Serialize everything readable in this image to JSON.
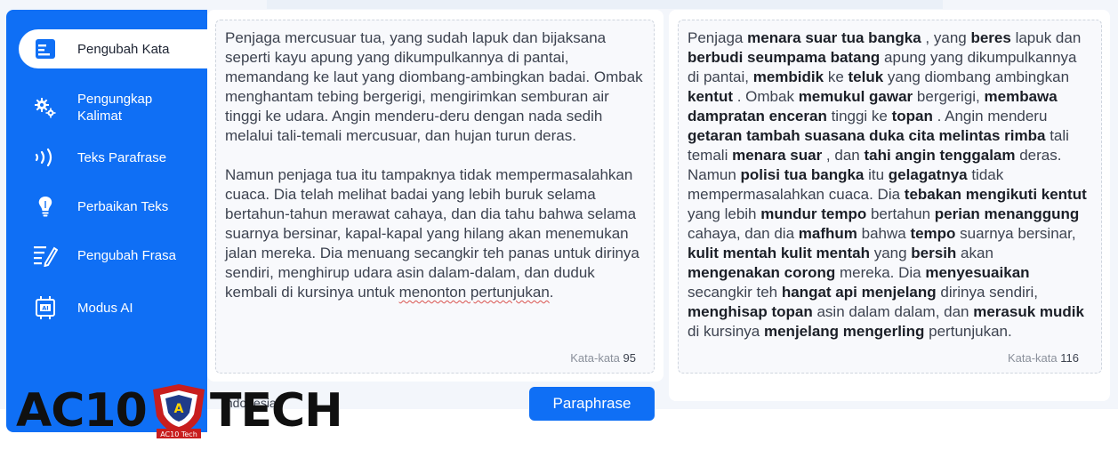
{
  "sidebar": {
    "items": [
      {
        "label": "Pengubah Kata",
        "icon": "document-icon",
        "active": true
      },
      {
        "label": "Pengungkap\nKalimat",
        "icon": "gears-icon",
        "active": false
      },
      {
        "label": "Teks Parafrase",
        "icon": "sound-waves-icon",
        "active": false
      },
      {
        "label": "Perbaikan Teks",
        "icon": "lightbulb-icon",
        "active": false
      },
      {
        "label": "Pengubah Frasa",
        "icon": "list-pencil-icon",
        "active": false
      },
      {
        "label": "Modus AI",
        "icon": "ai-chip-icon",
        "active": false
      }
    ]
  },
  "input": {
    "p1": "Penjaga mercusuar tua, yang sudah lapuk dan bijaksana seperti kayu apung yang dikumpulkannya di pantai, memandang ke laut yang diombang-ambingkan badai. Ombak menghantam tebing bergerigi, mengirimkan semburan air tinggi ke udara. Angin menderu-deru dengan nada sedih melalui tali-temali mercusuar, dan hujan turun deras.",
    "p2_main": "Namun penjaga tua itu tampaknya tidak mempermasalahkan cuaca. Dia telah melihat badai yang lebih buruk selama bertahun-tahun merawat cahaya, dan dia tahu bahwa selama suarnya bersinar, kapal-kapal yang hilang akan menemukan jalan mereka. Dia menuang secangkir teh panas untuk dirinya sendiri, menghirup udara asin dalam-dalam, dan duduk kembali di kursinya untuk ",
    "p2_end": "menonton pertunjukan",
    "p2_tail": ".",
    "word_count_label": "Kata-kata",
    "word_count": "95"
  },
  "output": {
    "segments": [
      [
        "Penjaga ",
        false
      ],
      [
        "menara suar tua bangka",
        true
      ],
      [
        " , yang ",
        false
      ],
      [
        "beres",
        true
      ],
      [
        " lapuk dan ",
        false
      ],
      [
        "berbudi seumpama batang",
        true
      ],
      [
        " apung yang dikumpulkannya di pantai, ",
        false
      ],
      [
        "membidik",
        true
      ],
      [
        " ke ",
        false
      ],
      [
        "teluk",
        true
      ],
      [
        " yang diombang ambingkan ",
        false
      ],
      [
        "kentut",
        true
      ],
      [
        " . Ombak ",
        false
      ],
      [
        "memukul gawar",
        true
      ],
      [
        " bergerigi, ",
        false
      ],
      [
        "membawa dampratan enceran",
        true
      ],
      [
        " tinggi ke ",
        false
      ],
      [
        "topan",
        true
      ],
      [
        " . Angin menderu ",
        false
      ],
      [
        "getaran tambah suasana duka cita melintas rimba",
        true
      ],
      [
        " tali temali ",
        false
      ],
      [
        "menara suar",
        true
      ],
      [
        " , dan ",
        false
      ],
      [
        "tahi angin tenggalam",
        true
      ],
      [
        " deras. Namun ",
        false
      ],
      [
        "polisi tua bangka",
        true
      ],
      [
        " itu ",
        false
      ],
      [
        "gelagatnya",
        true
      ],
      [
        " tidak mempermasalahkan cuaca. Dia ",
        false
      ],
      [
        "tebakan mengikuti kentut",
        true
      ],
      [
        " yang lebih ",
        false
      ],
      [
        "mundur tempo",
        true
      ],
      [
        " bertahun ",
        false
      ],
      [
        "perian menanggung",
        true
      ],
      [
        " cahaya, dan dia ",
        false
      ],
      [
        "mafhum",
        true
      ],
      [
        " bahwa ",
        false
      ],
      [
        "tempo",
        true
      ],
      [
        " suarnya bersinar, ",
        false
      ],
      [
        "kulit mentah kulit mentah",
        true
      ],
      [
        " yang ",
        false
      ],
      [
        "bersih",
        true
      ],
      [
        " akan ",
        false
      ],
      [
        "mengenakan corong",
        true
      ],
      [
        " mereka. Dia ",
        false
      ],
      [
        "menyesuaikan",
        true
      ],
      [
        " secangkir teh ",
        false
      ],
      [
        "hangat api menjelang",
        true
      ],
      [
        " dirinya sendiri, ",
        false
      ],
      [
        "menghisap topan",
        true
      ],
      [
        " asin dalam dalam, dan ",
        false
      ],
      [
        "merasuk mudik",
        true
      ],
      [
        " di kursinya ",
        false
      ],
      [
        "menjelang mengerling",
        true
      ],
      [
        " pertunjukan.",
        false
      ]
    ],
    "word_count_label": "Kata-kata",
    "word_count": "116"
  },
  "controls": {
    "paraphrase_label": "Paraphrase",
    "language_label": "Indonesian"
  },
  "watermark": {
    "left_text": "AC10",
    "right_text": "TECH",
    "badge_letter": "A",
    "badge_caption": "AC10 Tech"
  }
}
